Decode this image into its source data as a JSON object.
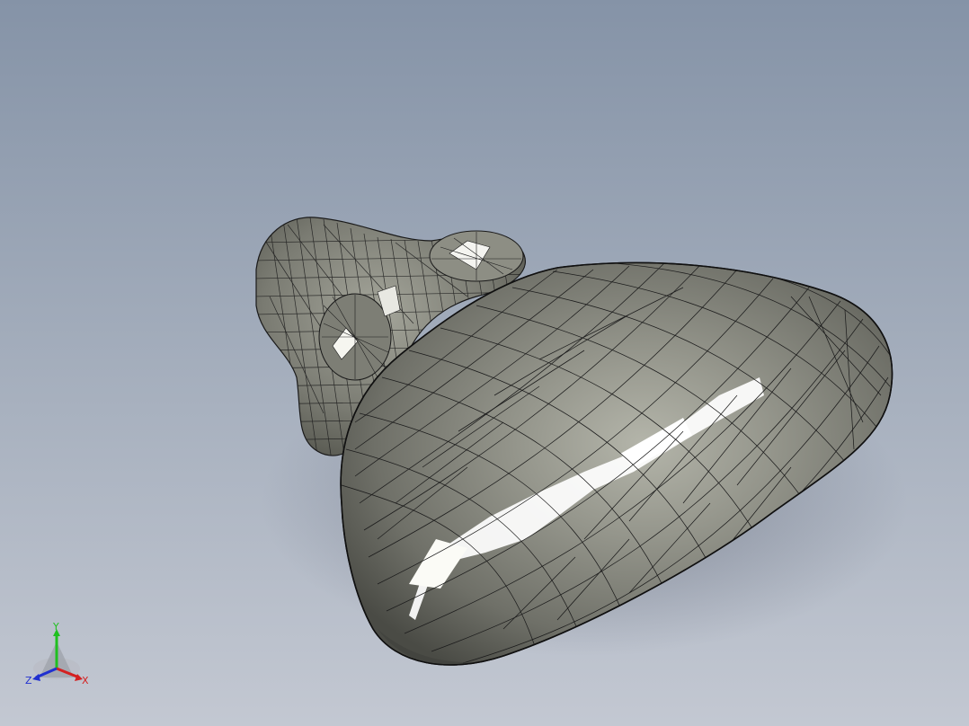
{
  "viewport": {
    "background_top": "#8593a7",
    "background_bottom": "#c3c8d2",
    "model": {
      "shading": "shaded-with-edges",
      "body_color": "#8a8b82",
      "highlight_color": "#ffffff",
      "edge_color": "#1a1a1a"
    }
  },
  "triad": {
    "x_label": "X",
    "y_label": "Y",
    "z_label": "Z",
    "x_color": "#d42020",
    "y_color": "#20c020",
    "z_color": "#2030d0"
  }
}
